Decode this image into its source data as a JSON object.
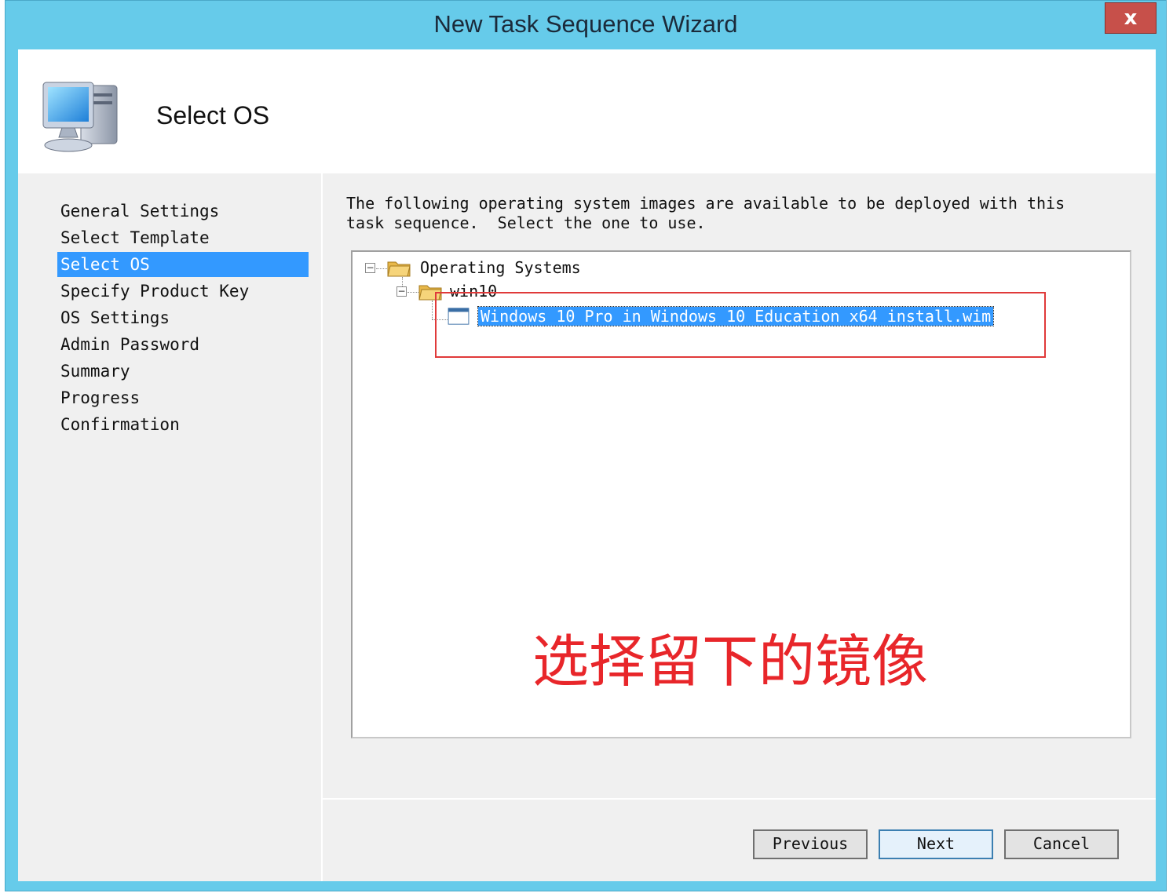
{
  "window": {
    "title": "New Task Sequence Wizard",
    "close_label": "x"
  },
  "header": {
    "title": "Select OS",
    "icon": "computer-icon"
  },
  "nav": {
    "items": [
      {
        "label": "General Settings",
        "active": false
      },
      {
        "label": "Select Template",
        "active": false
      },
      {
        "label": "Select OS",
        "active": true
      },
      {
        "label": "Specify Product Key",
        "active": false
      },
      {
        "label": "OS Settings",
        "active": false
      },
      {
        "label": "Admin Password",
        "active": false
      },
      {
        "label": "Summary",
        "active": false
      },
      {
        "label": "Progress",
        "active": false
      },
      {
        "label": "Confirmation",
        "active": false
      }
    ]
  },
  "content": {
    "description": "The following operating system images are available to be deployed with this\ntask sequence.  Select the one to use.",
    "tree": {
      "root": {
        "label": "Operating Systems",
        "expander": "−",
        "icon": "folder-icon"
      },
      "folder": {
        "label": "win10",
        "expander": "−",
        "icon": "folder-icon"
      },
      "item": {
        "label": "Windows 10 Pro in Windows 10 Education x64 install.wim",
        "icon": "os-image-icon",
        "selected": true
      }
    }
  },
  "annotation": {
    "text": "选择留下的镜像",
    "color": "#e8262a"
  },
  "buttons": {
    "previous": "Previous",
    "next": "Next",
    "cancel": "Cancel"
  },
  "colors": {
    "titlebar": "#66cbea",
    "selection": "#3399ff",
    "close": "#c7504a"
  }
}
